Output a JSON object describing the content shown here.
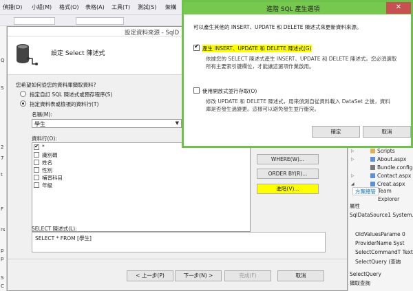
{
  "menu": [
    "偵錯(D)",
    "小組(M)",
    "格式(O)",
    "表格(A)",
    "工具(T)",
    "測試(S)",
    "架構"
  ],
  "left_strip_labels": [
    "Q",
    "S",
    "2",
    "7",
    "t",
    "F",
    "rs",
    "p",
    "p",
    "S",
    "C"
  ],
  "wizard": {
    "title": "設定資料來源 - SqlD",
    "header": "設定 Select 陳述式",
    "question": "您希望如何從您的資料庫擷取資料?",
    "radio_custom": "指定自訂 SQL 陳述式或預存程序(S)",
    "radio_table": "指定資料表或檢視的資料行(T)",
    "name_label": "名稱(M):",
    "table_value": "學生",
    "columns_label": "資料行(O):",
    "columns": [
      "*",
      "識別碼",
      "姓名",
      "性別",
      "補習科目",
      "年級"
    ],
    "where_btn": "WHERE(W)...",
    "orderby_btn": "ORDER BY(R)...",
    "advanced_btn": "進階(V)...",
    "sql_label": "SELECT 陳述式(L):",
    "sql_value": "SELECT * FROM [學生]",
    "prev_btn": "< 上一步(P)",
    "next_btn": "下一步(N) >",
    "finish_btn": "完成(F)",
    "cancel_btn": "取消"
  },
  "solution_explorer": {
    "items": [
      "Scripts",
      "About.aspx",
      "Bundle.config",
      "Contact.aspx",
      "Creat.aspx"
    ],
    "tabs": [
      "方案總管",
      "Team Explorer"
    ]
  },
  "properties": {
    "title": "屬性",
    "object": "SqlDataSource1 System.",
    "rows": [
      "OldValuesParame 0",
      "ProviderName Syst",
      "SelectCommandT Text",
      "SelectQuery (查詢"
    ],
    "desc_title": "SelectQuery",
    "desc_text": "擷取查詢"
  },
  "advanced": {
    "title": "進階 SQL 產生選項",
    "intro": "可以產生其他的 INSERT、UPDATE 和 DELETE 陳述式來更新資料來源。",
    "opt1_label": "產生 INSERT、UPDATE 和 DELETE 陳述式(G)",
    "opt1_desc1": "依據您的 SELECT 陳述式產生 INSERT、UPDATE 和 DELETE 陳述式。您必須選取",
    "opt1_desc2": "所有主要索引鍵欄位，才能讓這選項作業啟用。",
    "opt2_label": "使用開放式並行存取(O)",
    "opt2_desc1": "修改 UPDATE 和 DELETE 陳述式，用來偵測自從資料載入 DataSet 之後，資料",
    "opt2_desc2": "庫是否發生過變更。這樣可以避免發生並行衝突。",
    "ok_btn": "確定",
    "cancel_btn": "取消",
    "close_glyph": "✕"
  },
  "colors": {
    "dialog_green": "#77c84f",
    "highlight_yellow": "#ffff00",
    "close_red": "#c75050"
  }
}
